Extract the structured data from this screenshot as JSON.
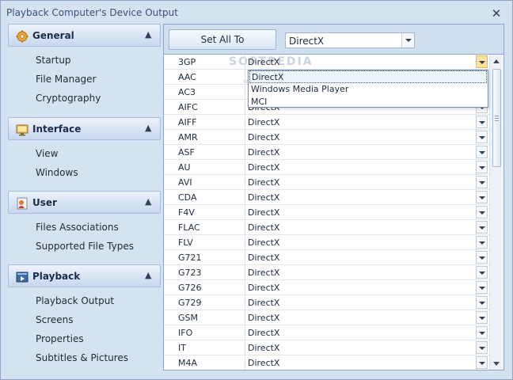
{
  "window": {
    "title": "Playback Computer's Device Output",
    "close_glyph": "✕"
  },
  "sidebar": {
    "sections": [
      {
        "title": "General",
        "icon": "gear-icon",
        "items": [
          "Startup",
          "File Manager",
          "Cryptography"
        ]
      },
      {
        "title": "Interface",
        "icon": "monitor-icon",
        "items": [
          "View",
          "Windows"
        ]
      },
      {
        "title": "User",
        "icon": "user-icon",
        "items": [
          "Files Associations",
          "Supported File Types"
        ]
      },
      {
        "title": "Playback",
        "icon": "playback-icon",
        "items": [
          "Playback Output",
          "Screens",
          "Properties",
          "Subtitles & Pictures"
        ]
      }
    ],
    "chevron": "▲"
  },
  "toolbar": {
    "set_all_label": "Set All To",
    "set_all_value": "DirectX"
  },
  "grid": {
    "rows": [
      {
        "format": "3GP",
        "output": "DirectX"
      },
      {
        "format": "AAC",
        "output": "DirectX"
      },
      {
        "format": "AC3",
        "output": "DirectX"
      },
      {
        "format": "AIFC",
        "output": "DirectX"
      },
      {
        "format": "AIFF",
        "output": "DirectX"
      },
      {
        "format": "AMR",
        "output": "DirectX"
      },
      {
        "format": "ASF",
        "output": "DirectX"
      },
      {
        "format": "AU",
        "output": "DirectX"
      },
      {
        "format": "AVI",
        "output": "DirectX"
      },
      {
        "format": "CDA",
        "output": "DirectX"
      },
      {
        "format": "F4V",
        "output": "DirectX"
      },
      {
        "format": "FLAC",
        "output": "DirectX"
      },
      {
        "format": "FLV",
        "output": "DirectX"
      },
      {
        "format": "G721",
        "output": "DirectX"
      },
      {
        "format": "G723",
        "output": "DirectX"
      },
      {
        "format": "G726",
        "output": "DirectX"
      },
      {
        "format": "G729",
        "output": "DirectX"
      },
      {
        "format": "GSM",
        "output": "DirectX"
      },
      {
        "format": "IFO",
        "output": "DirectX"
      },
      {
        "format": "IT",
        "output": "DirectX"
      },
      {
        "format": "M4A",
        "output": "DirectX"
      }
    ],
    "dropdown_options": [
      "DirectX",
      "Windows Media Player",
      "MCI"
    ],
    "watermark": "SOFTPEDIA",
    "watermark_url": "www.softpedia.com"
  }
}
